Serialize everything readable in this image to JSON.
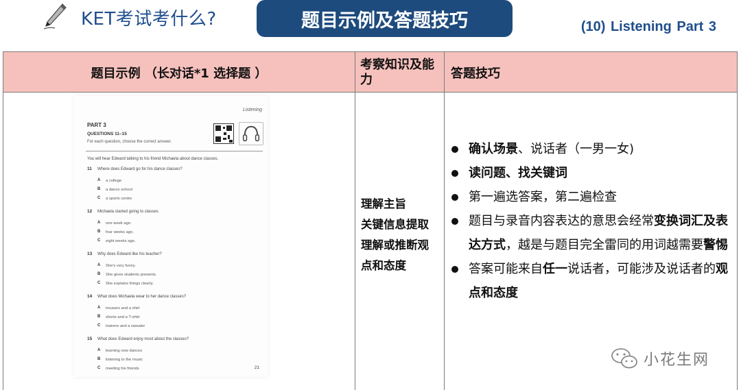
{
  "header": {
    "brand_title": "KET考试考什么?",
    "pill_title": "题目示例及答题技巧",
    "section_tag": "(10) Listening   Part 3"
  },
  "table": {
    "col1_header": "题目示例 （长对话*1 选择题 ）",
    "col2_header": "考察知识及能力",
    "col3_header": "答题技巧"
  },
  "exam": {
    "running_head": "Listening",
    "part": "PART 3",
    "questions": "QUESTIONS 11–15",
    "instruction": "For each question, choose the correct answer.",
    "intro": "You will hear Edward talking to his friend Michaela about dance classes.",
    "items": [
      {
        "num": "11",
        "text": "Where does Edward go for his dance classes?",
        "options": [
          [
            "A",
            "a college"
          ],
          [
            "B",
            "a dance school"
          ],
          [
            "C",
            "a sports centre"
          ]
        ]
      },
      {
        "num": "12",
        "text": "Michaela started going to classes",
        "options": [
          [
            "A",
            "one week ago."
          ],
          [
            "B",
            "four weeks ago."
          ],
          [
            "C",
            "eight weeks ago."
          ]
        ]
      },
      {
        "num": "13",
        "text": "Why does Edward like his teacher?",
        "options": [
          [
            "A",
            "She's very funny."
          ],
          [
            "B",
            "She gives students presents."
          ],
          [
            "C",
            "She explains things clearly."
          ]
        ]
      },
      {
        "num": "14",
        "text": "What does Michaela wear to her dance classes?",
        "options": [
          [
            "A",
            "trousers and a shirt"
          ],
          [
            "B",
            "shorts and a T-shirt"
          ],
          [
            "C",
            "trainers and a sweater"
          ]
        ]
      },
      {
        "num": "15",
        "text": "What does Edward enjoy most about the classes?",
        "options": [
          [
            "A",
            "learning new dances"
          ],
          [
            "B",
            "listening to the music"
          ],
          [
            "C",
            "meeting his friends"
          ]
        ]
      }
    ],
    "page_number": "21"
  },
  "abilities": [
    "理解主旨",
    "关键信息提取",
    "理解或推断观",
    "点和态度"
  ],
  "tips": [
    [
      {
        "t": "确认场景",
        "b": true
      },
      {
        "t": "、说话者（一男一女)",
        "b": false
      }
    ],
    [
      {
        "t": "读问题、找关键词",
        "b": true
      }
    ],
    [
      {
        "t": " 第一遍选答案，第二遍检查",
        "b": false
      }
    ],
    [
      {
        "t": "题目与录音内容表达的意思会经常",
        "b": false
      },
      {
        "t": "变换词汇及表达方式",
        "b": true
      },
      {
        "t": "，越是与题目完全雷同的用词越需要",
        "b": false
      },
      {
        "t": "警惕",
        "b": true
      }
    ],
    [
      {
        "t": "答案可能来自",
        "b": false
      },
      {
        "t": "任一",
        "b": true
      },
      {
        "t": "说话者，可能涉及说话者的",
        "b": false
      },
      {
        "t": "观点和态度",
        "b": true
      }
    ]
  ],
  "watermark": {
    "text": "小花生网",
    "icon": "wechat-icon"
  },
  "colors": {
    "navy": "#1e4b7d",
    "header_pink": "#f6c1bd",
    "brand_blue": "#1f4e8c"
  }
}
